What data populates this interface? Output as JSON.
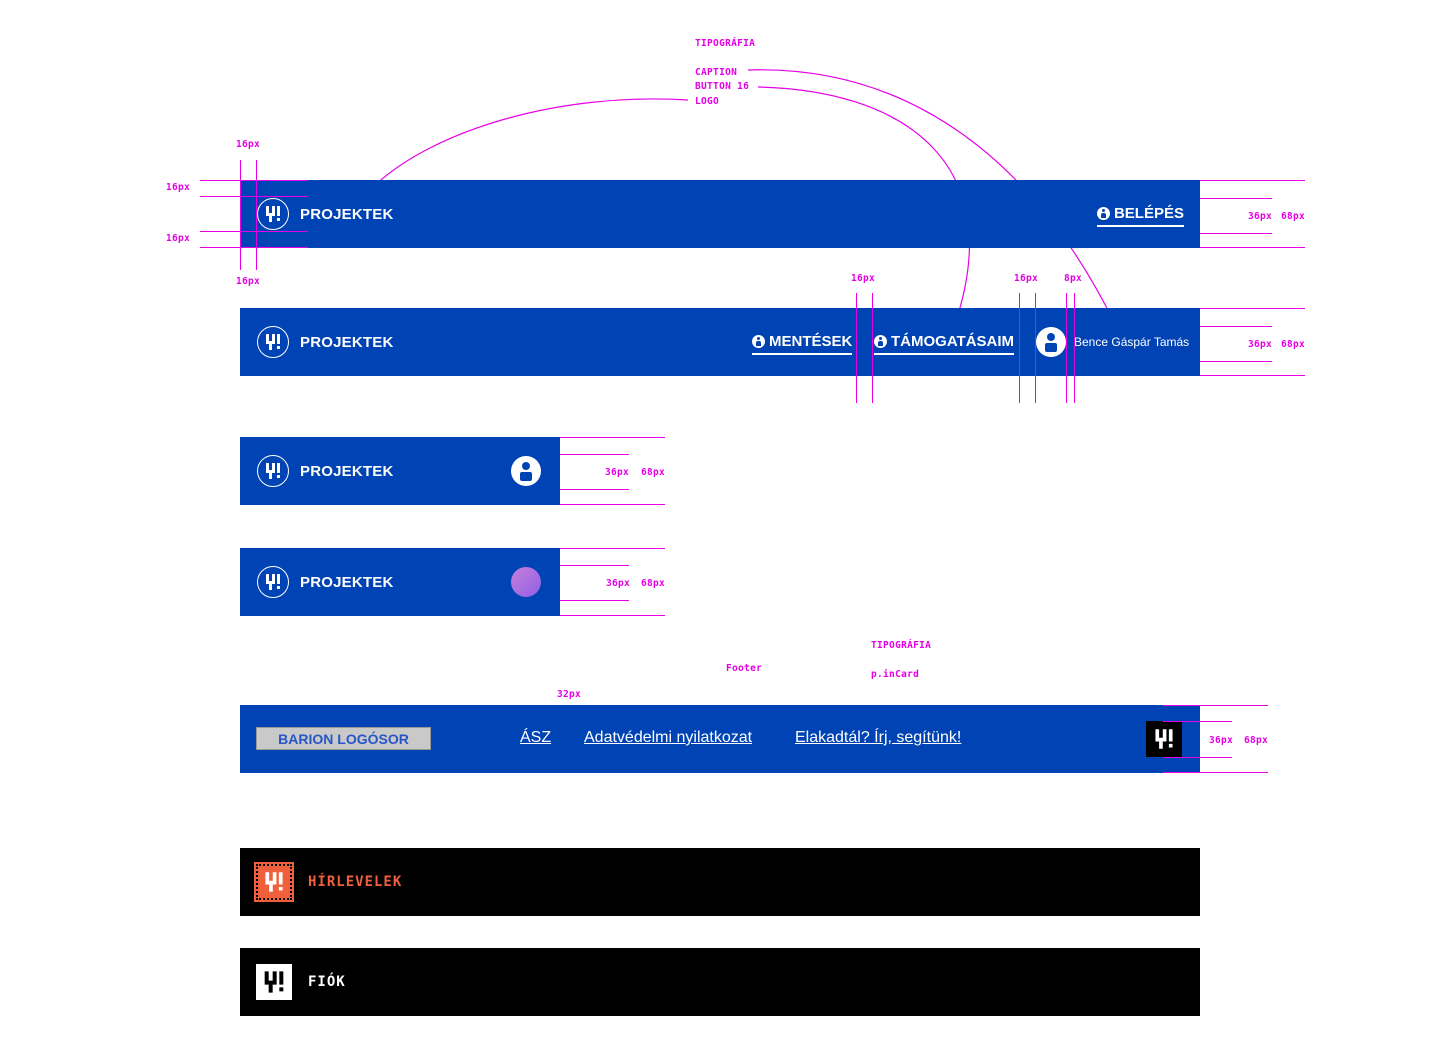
{
  "annotations": {
    "tipografia_top": "TIPOGRÁFIA",
    "caption": "CAPTION",
    "button16": "BUTTON 16",
    "logo": "LOGO",
    "px16": "16px",
    "px8": "8px",
    "px36": "36px",
    "px68": "68px",
    "px32": "32px",
    "footer_label": "Footer",
    "tipografia_footer": "TIPOGRÁFIA",
    "pincard": "p.inCard"
  },
  "header": {
    "brand": "PROJEKTEK",
    "login_label": "BELÉPÉS",
    "saved_label": "MENTÉSEK",
    "supports_label": "TÁMOGATÁSAIM",
    "user_name": "Bence Gáspár Tamás"
  },
  "footer": {
    "barion": "BARION LOGÓSOR",
    "links": [
      "ÁSZ",
      "Adatvédelmi nyilatkozat",
      "Elakadtál? Írj, segítünk!"
    ]
  },
  "newsletter": {
    "label": "HÍRLEVELEK",
    "accent": "#f0603c"
  },
  "account": {
    "label": "FIÓK"
  },
  "colors": {
    "brand_blue": "#0043b5",
    "annotation": "#e600e6",
    "black": "#000000"
  },
  "icons": [
    "logo-4-icon",
    "info-icon",
    "user-avatar-icon",
    "gradient-avatar"
  ]
}
